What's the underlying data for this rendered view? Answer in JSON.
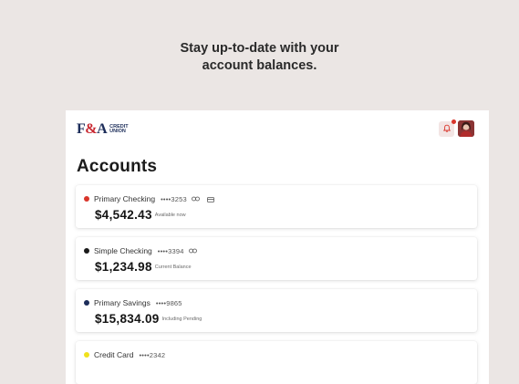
{
  "tagline": {
    "line1": "Stay up-to-date with your",
    "line2": "account balances."
  },
  "header": {
    "logo_mark_left": "F",
    "logo_mark_amp": "&",
    "logo_mark_right": "A",
    "logo_text_line1": "CREDIT",
    "logo_text_line2": "UNION",
    "notification_icon": "bell-icon",
    "has_unread": true
  },
  "page": {
    "title": "Accounts"
  },
  "accounts": [
    {
      "name": "Primary Checking",
      "mask": "••••3253",
      "icons": [
        "link-icon",
        "card-icon"
      ],
      "amount": "$4,542.43",
      "note": "Available now",
      "color": "#d9352b"
    },
    {
      "name": "Simple Checking",
      "mask": "••••3394",
      "icons": [
        "link-icon"
      ],
      "amount": "$1,234.98",
      "note": "Current Balance",
      "color": "#1a1a1a"
    },
    {
      "name": "Primary Savings",
      "mask": "••••9865",
      "icons": [],
      "amount": "$15,834.09",
      "note": "Including Pending",
      "color": "#1c2d5a"
    },
    {
      "name": "Credit Card",
      "mask": "••••2342",
      "icons": [],
      "amount": "",
      "note": "",
      "color": "#f0e11c"
    }
  ],
  "colors": {
    "background": "#ebe6e4",
    "brand_navy": "#1c2d5a",
    "brand_red": "#c8262f"
  }
}
